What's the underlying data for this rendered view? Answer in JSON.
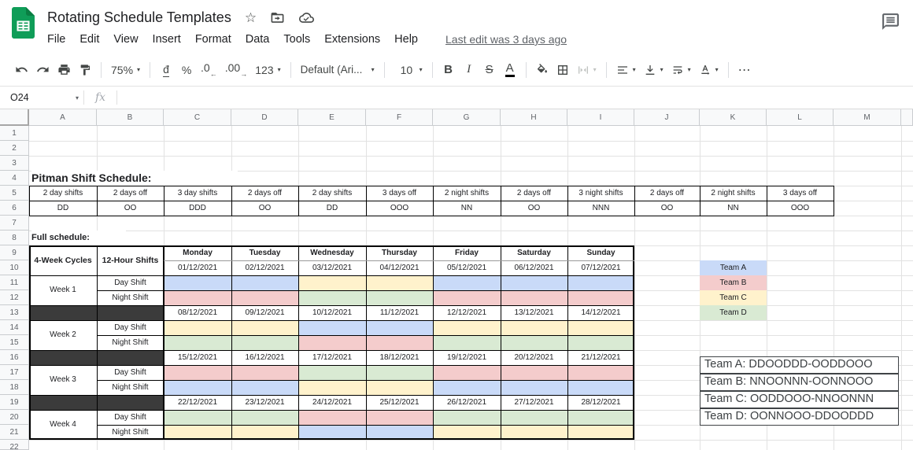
{
  "titlebar": {
    "title": "Rotating Schedule Templates",
    "menus": [
      "File",
      "Edit",
      "View",
      "Insert",
      "Format",
      "Data",
      "Tools",
      "Extensions",
      "Help"
    ],
    "last_edit": "Last edit was 3 days ago"
  },
  "glyphs": {
    "star": "☆",
    "dropdown": "▾",
    "arrow_left": "←",
    "arrow_right": "→",
    "more": "⋯"
  },
  "toolbar": {
    "zoom": "75%",
    "currency": "đ",
    "percent": "%",
    "decrease_decimal": ".0",
    "increase_decimal": ".00",
    "number_format": "123",
    "font_name": "Default (Ari...",
    "font_size": "10",
    "bold": "B",
    "italic": "I",
    "strikethrough": "S",
    "text_color": "A"
  },
  "formula_bar": {
    "cell_ref": "O24",
    "fx_label": "fx"
  },
  "grid": {
    "column_letters": [
      "A",
      "B",
      "C",
      "D",
      "E",
      "F",
      "G",
      "H",
      "I",
      "J",
      "K",
      "L",
      "M",
      ""
    ],
    "visible_rows": 22
  },
  "sheet": {
    "pitman_title": "Pitman Shift Schedule:",
    "pitman_row1": [
      "2 day shifts",
      "2 days off",
      "3 day shifts",
      "2 days off",
      "2 day shifts",
      "3 days off",
      "2 night shifts",
      "2 days off",
      "3 night shifts",
      "2 days off",
      "2 night shifts",
      "3 days off"
    ],
    "pitman_row2": [
      "DD",
      "OO",
      "DDD",
      "OO",
      "DD",
      "OOO",
      "NN",
      "OO",
      "NNN",
      "OO",
      "NN",
      "OOO"
    ],
    "full_schedule_title": "Full schedule:",
    "cycles_header": "4-Week Cycles",
    "shifts_header": "12-Hour Shifts",
    "day_shift_label": "Day Shift",
    "night_shift_label": "Night Shift",
    "days": [
      "Monday",
      "Tuesday",
      "Wednesday",
      "Thursday",
      "Friday",
      "Saturday",
      "Sunday"
    ],
    "weeks": [
      {
        "label": "Week 1",
        "dates": [
          "01/12/2021",
          "02/12/2021",
          "03/12/2021",
          "04/12/2021",
          "05/12/2021",
          "06/12/2021",
          "07/12/2021"
        ],
        "day_shift_teams": [
          "A",
          "A",
          "C",
          "C",
          "A",
          "A",
          "A"
        ],
        "night_shift_teams": [
          "B",
          "B",
          "D",
          "D",
          "B",
          "B",
          "B"
        ]
      },
      {
        "label": "Week 2",
        "dates": [
          "08/12/2021",
          "09/12/2021",
          "10/12/2021",
          "11/12/2021",
          "12/12/2021",
          "13/12/2021",
          "14/12/2021"
        ],
        "day_shift_teams": [
          "C",
          "C",
          "A",
          "A",
          "C",
          "C",
          "C"
        ],
        "night_shift_teams": [
          "D",
          "D",
          "B",
          "B",
          "D",
          "D",
          "D"
        ]
      },
      {
        "label": "Week 3",
        "dates": [
          "15/12/2021",
          "16/12/2021",
          "17/12/2021",
          "18/12/2021",
          "19/12/2021",
          "20/12/2021",
          "21/12/2021"
        ],
        "day_shift_teams": [
          "B",
          "B",
          "D",
          "D",
          "B",
          "B",
          "B"
        ],
        "night_shift_teams": [
          "A",
          "A",
          "C",
          "C",
          "A",
          "A",
          "A"
        ]
      },
      {
        "label": "Week 4",
        "dates": [
          "22/12/2021",
          "23/12/2021",
          "24/12/2021",
          "25/12/2021",
          "26/12/2021",
          "27/12/2021",
          "28/12/2021"
        ],
        "day_shift_teams": [
          "D",
          "D",
          "B",
          "B",
          "D",
          "D",
          "D"
        ],
        "night_shift_teams": [
          "C",
          "C",
          "A",
          "A",
          "C",
          "C",
          "C"
        ]
      }
    ],
    "teams": [
      {
        "name": "Team A",
        "color": "#c9daf8"
      },
      {
        "name": "Team B",
        "color": "#f4cccc"
      },
      {
        "name": "Team C",
        "color": "#fff2cc"
      },
      {
        "name": "Team D",
        "color": "#d9ead3"
      }
    ],
    "team_patterns": [
      "Team A: DDOODDD-OODDOOO",
      "Team B: NNOONNN-OONNOOO",
      "Team C: OODDOOO-NNOONNN",
      "Team D: OONNOOO-DDOODDD"
    ],
    "colors": {
      "divider_cell": "#3b3b3b"
    }
  }
}
